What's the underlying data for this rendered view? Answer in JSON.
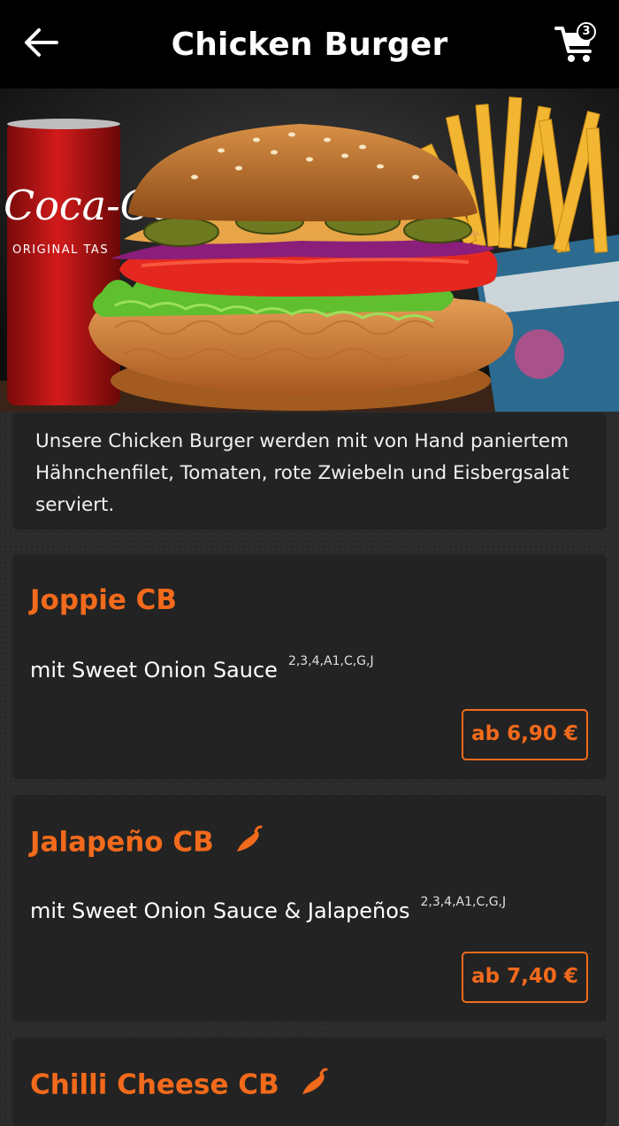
{
  "header": {
    "title": "Chicken Burger",
    "cart_count": "3"
  },
  "hero": {
    "can_text_1": "Coca-Co",
    "can_text_2": "ORIGINAL TAS"
  },
  "description": "Unsere Chicken Burger werden mit von Hand paniertem Hähnchenfilet, Tomaten, rote Zwiebeln und Eisbergsalat serviert.",
  "products": [
    {
      "name": "Joppie CB",
      "description": "mit Sweet Onion Sauce",
      "allergens": "2,3,4,A1,C,G,J",
      "price": "ab 6,90 €",
      "spicy": false
    },
    {
      "name": "Jalapeño CB",
      "description": "mit Sweet Onion Sauce & Jalapeños",
      "allergens": "2,3,4,A1,C,G,J",
      "price": "ab 7,40 €",
      "spicy": true
    },
    {
      "name": "Chilli Cheese CB",
      "spicy": true
    }
  ],
  "colors": {
    "accent": "#f26a1b",
    "card": "#232323",
    "header": "#000000"
  },
  "icons": [
    "back-arrow-icon",
    "cart-icon",
    "chili-icon"
  ]
}
